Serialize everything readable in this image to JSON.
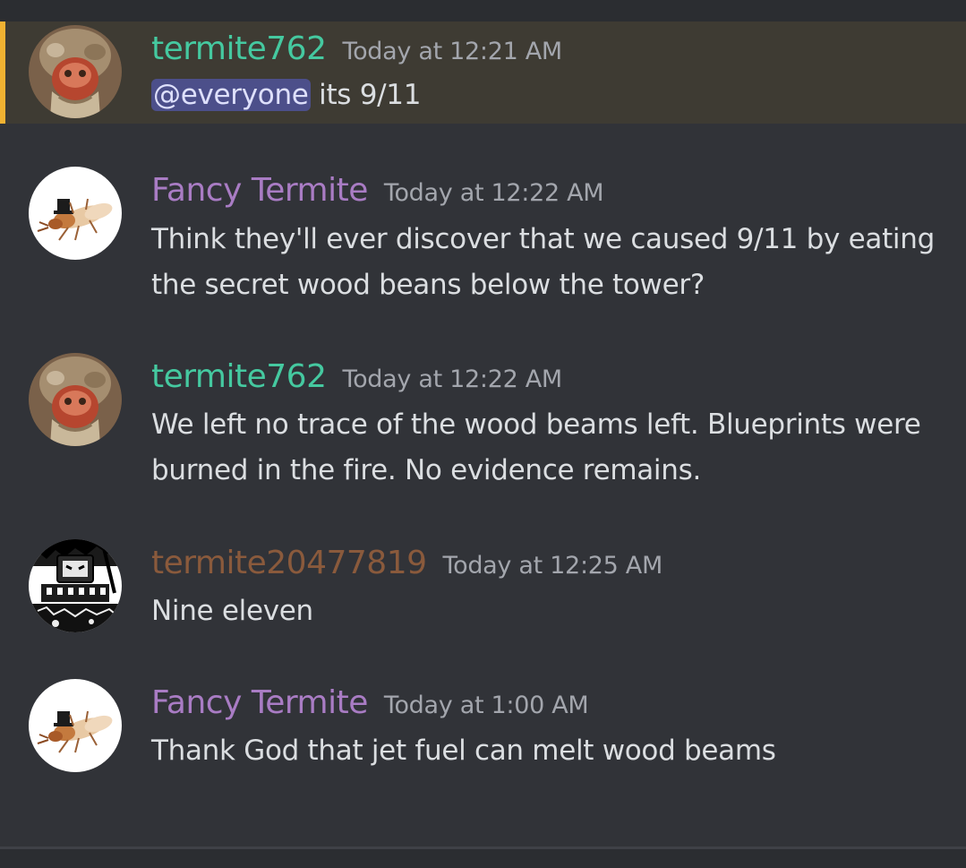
{
  "colors": {
    "background": "#313338",
    "mention_highlight": "#3e3b33",
    "mention_bar": "#f0b232",
    "mention_pill": "#4c4f8a"
  },
  "messages": [
    {
      "username": "termite762",
      "username_color": "#45c9a0",
      "avatar_icon": "soldier-avatar-icon",
      "timestamp": "Today at 12:21 AM",
      "mention": "@everyone",
      "text": " its 9/11"
    },
    {
      "username": "Fancy Termite",
      "username_color": "#a97cc4",
      "avatar_icon": "termite-tophat-avatar-icon",
      "timestamp": "Today at 12:22 AM",
      "text": "Think they'll ever discover that we caused 9/11 by eating the secret wood beans below the tower?"
    },
    {
      "username": "termite762",
      "username_color": "#45c9a0",
      "avatar_icon": "soldier-avatar-icon",
      "timestamp": "Today at 12:22 AM",
      "text": "We left no trace of the wood beams left. Blueprints were burned in the fire. No evidence remains."
    },
    {
      "username": "termite20477819",
      "username_color": "#8a5a3c",
      "avatar_icon": "robot-avatar-icon",
      "timestamp": "Today at 12:25 AM",
      "text": "Nine eleven"
    },
    {
      "username": "Fancy Termite",
      "username_color": "#a97cc4",
      "avatar_icon": "termite-tophat-avatar-icon",
      "timestamp": "Today at 1:00 AM",
      "text": "Thank God that jet fuel can melt wood beams"
    }
  ]
}
